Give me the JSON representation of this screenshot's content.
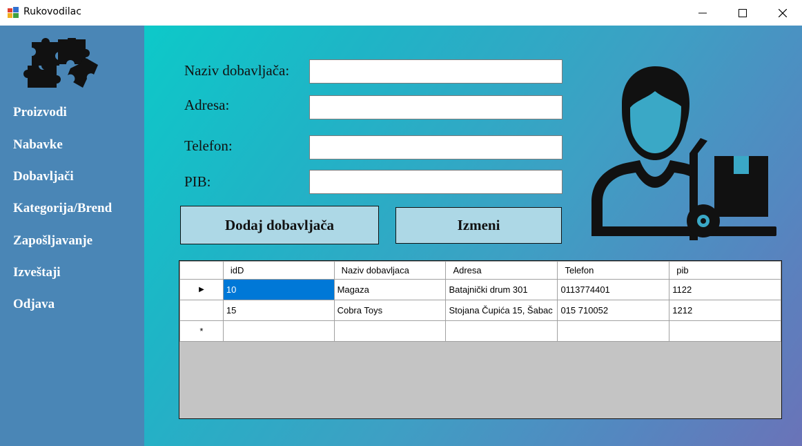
{
  "window": {
    "title": "Rukovodilac",
    "icons": {
      "app": "app-icon",
      "minimize": "minimize-icon",
      "maximize": "maximize-icon",
      "close": "close-icon"
    }
  },
  "sidebar": {
    "logo_icon": "puzzle-pieces-icon",
    "items": [
      {
        "label": "Proizvodi"
      },
      {
        "label": "Nabavke"
      },
      {
        "label": "Dobavljači"
      },
      {
        "label": "Kategorija/Brend"
      },
      {
        "label": "Zapošljavanje"
      },
      {
        "label": "Izveštaji"
      },
      {
        "label": "Odjava"
      }
    ]
  },
  "form": {
    "naziv_label": "Naziv dobavljača:",
    "naziv_value": "",
    "adresa_label": "Adresa:",
    "adresa_value": "",
    "telefon_label": "Telefon:",
    "telefon_value": "",
    "pib_label": "PIB:",
    "pib_value": "",
    "add_button": "Dodaj dobavljača",
    "edit_button": "Izmeni"
  },
  "illustration_icon": "delivery-person-icon",
  "grid": {
    "columns": [
      "idD",
      "Naziv dobavljaca",
      "Adresa",
      "Telefon",
      "pib"
    ],
    "rows": [
      [
        "10",
        "Magaza",
        "Batajnički drum 301",
        "0113774401",
        "1122"
      ],
      [
        "15",
        "Cobra Toys",
        "Stojana Čupića 15, Šabac",
        "015 710052",
        "1212"
      ]
    ],
    "current_row_marker": "▶",
    "new_row_marker": "*"
  },
  "colors": {
    "sidebar": "#4a86b6",
    "button": "#add8e6",
    "selection": "#0078d7",
    "gradient_start": "#0dc9c9",
    "gradient_end": "#6a73b8"
  }
}
